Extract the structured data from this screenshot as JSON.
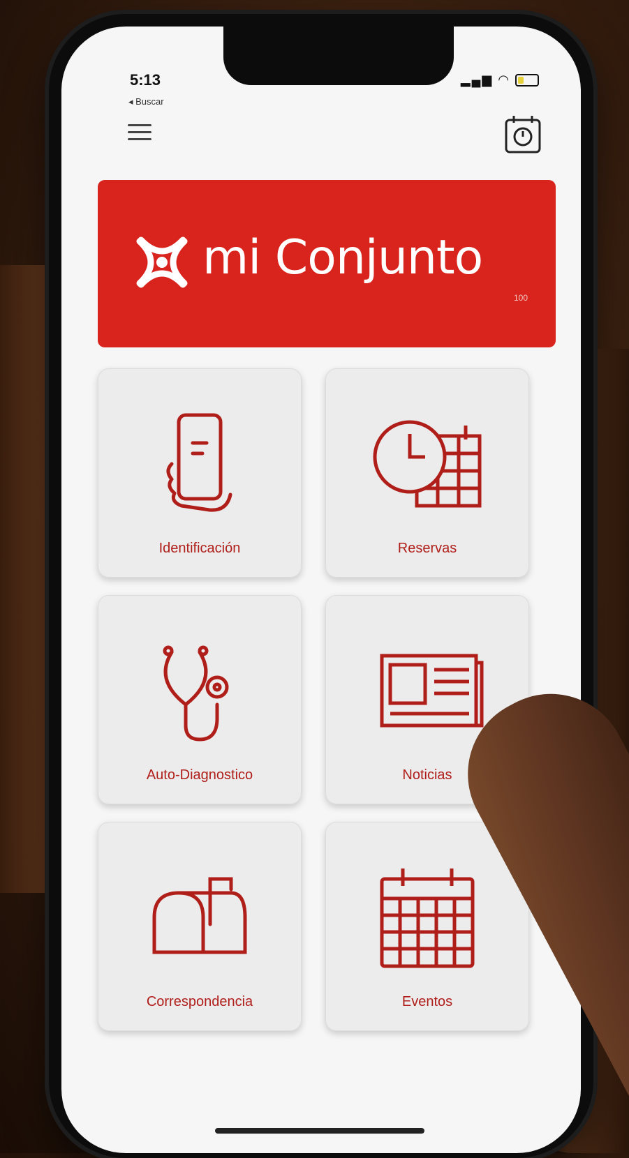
{
  "status_bar": {
    "time": "5:13",
    "back_label": "◂ Buscar",
    "signal_icons": "▂▄▆ ◠"
  },
  "header": {
    "menu_icon": "hamburger-icon",
    "action_icon": "calendar-clock-icon"
  },
  "banner": {
    "title": "mi Conjunto",
    "subtitle": "100"
  },
  "tiles": [
    {
      "label": "Identificación",
      "icon": "phone-hand-icon"
    },
    {
      "label": "Reservas",
      "icon": "clock-calendar-icon"
    },
    {
      "label": "Auto-Diagnostico",
      "icon": "stethoscope-icon"
    },
    {
      "label": "Noticias",
      "icon": "newspaper-icon"
    },
    {
      "label": "Correspondencia",
      "icon": "mailbox-icon"
    },
    {
      "label": "Eventos",
      "icon": "calendar-icon"
    }
  ],
  "colors": {
    "accent": "#d9231d",
    "tile_bg": "#ececec",
    "label": "#b01e1a"
  }
}
